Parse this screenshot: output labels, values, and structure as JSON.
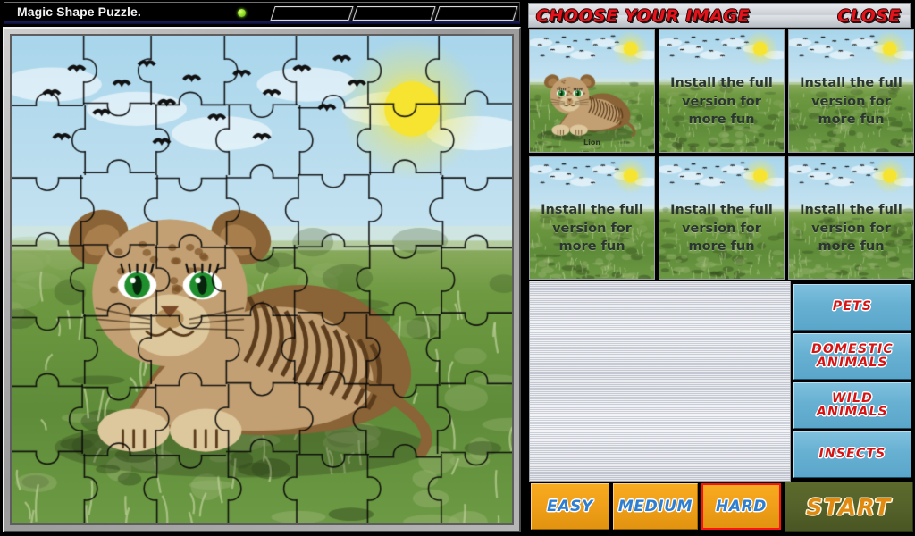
{
  "window": {
    "title": "Magic Shape Puzzle.",
    "status_led_color": "#8ddc27",
    "titlebar_slots": [
      "slot-1",
      "slot-2",
      "slot-3"
    ]
  },
  "puzzle": {
    "name": "Lion",
    "scene": "lion cub lying in grass under sun with birds in sky",
    "piece_outline_color": "#111111",
    "sky_color": "#a8d5ea",
    "grass_color": "#6f9a42",
    "sun_color": "#f6e430",
    "fur_color": "#c4a172",
    "eye_color": "#1f8f2e"
  },
  "right_panel": {
    "header": {
      "title": "CHOOSE YOUR IMAGE",
      "close_label": "CLOSE",
      "title_color": "#e2131b"
    },
    "thumbnails": [
      {
        "caption": "",
        "name": "Lion",
        "locked": false
      },
      {
        "caption": "Install the full\nversion\nfor more fun",
        "name": "",
        "locked": true
      },
      {
        "caption": "Install the full\nversion\nfor more fun",
        "name": "",
        "locked": true
      },
      {
        "caption": "Install the full\nversion\nfor more fun",
        "name": "",
        "locked": true
      },
      {
        "caption": "Install the full\nversion\nfor more fun",
        "name": "",
        "locked": true
      },
      {
        "caption": "Install the full\nversion\nfor more fun",
        "name": "",
        "locked": true
      }
    ],
    "categories": [
      {
        "label": "PETS"
      },
      {
        "label": "DOMESTIC\nANIMALS"
      },
      {
        "label": "WILD\nANIMALS"
      },
      {
        "label": "INSECTS"
      }
    ],
    "category_color": "#67b0d2",
    "category_text_color": "#d61414",
    "difficulties": [
      {
        "label": "EASY",
        "selected": false
      },
      {
        "label": "MEDIUM",
        "selected": false
      },
      {
        "label": "HARD",
        "selected": true
      }
    ],
    "difficulty_color": "#f0a01a",
    "difficulty_text_color": "#2f7fd0",
    "selected_outline_color": "#ff1111",
    "start": {
      "label": "START",
      "background_color": "#55622a",
      "text_color": "#e08a12"
    }
  }
}
